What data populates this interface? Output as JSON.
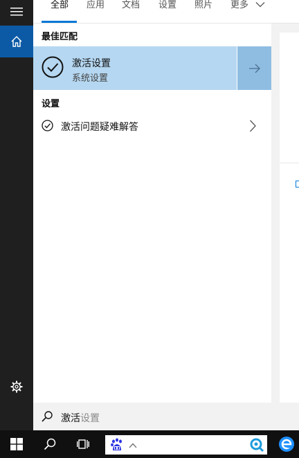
{
  "tabs": [
    {
      "label": "全部"
    },
    {
      "label": "应用"
    },
    {
      "label": "文档"
    },
    {
      "label": "设置"
    },
    {
      "label": "照片"
    },
    {
      "label": "更多"
    }
  ],
  "sections": {
    "best_match": "最佳匹配",
    "settings": "设置"
  },
  "best_match_item": {
    "title": "激活设置",
    "subtitle": "系统设置"
  },
  "settings_item": {
    "label": "激活问题疑难解答"
  },
  "search": {
    "typed": "激活",
    "suggestion": "设置"
  },
  "colors": {
    "accent": "#0078d7",
    "selected_bg": "#b5d7f1",
    "arrow_bg": "#8fbde2",
    "rail_bg": "#1f1f1f",
    "home_bg": "#0c5aa6"
  },
  "icons": {
    "menu": "hamburger-icon",
    "home": "home-icon",
    "settings": "gear-icon",
    "search": "search-icon",
    "windows": "windows-logo-icon",
    "task_view": "task-view-icon",
    "baidu": "baidu-paw-icon",
    "edge": "ie-edge-icon"
  }
}
